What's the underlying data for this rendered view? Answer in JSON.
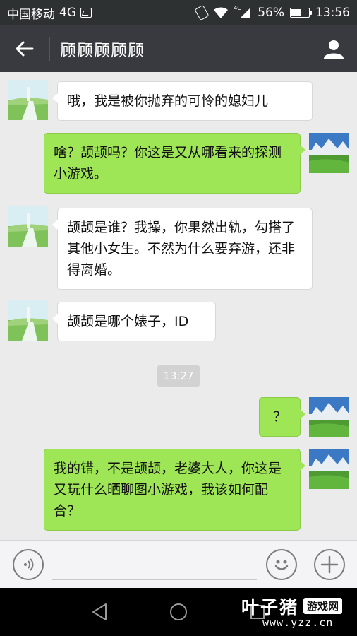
{
  "status_bar": {
    "carrier": "中国移动",
    "network": "4G",
    "signal_tag": "4G",
    "battery_percent": "56%",
    "battery_level": 0.56,
    "time": "13:56"
  },
  "header": {
    "title": "顾顾顾顾顾"
  },
  "messages": [
    {
      "side": "in",
      "text": "哦，我是被你抛弃的可怜的媳妇儿"
    },
    {
      "side": "out",
      "text": "啥？颉颉吗？你这是又从哪看来的探测小游戏。"
    },
    {
      "side": "in",
      "text": "颉颉是谁？我操，你果然出轨，勾搭了其他小女生。不然为什么要弃游，还非得离婚。"
    },
    {
      "side": "in",
      "text": "颉颉是哪个婊子，ID"
    },
    {
      "side": "out",
      "text": "？"
    },
    {
      "side": "out",
      "text": "我的错，不是颉颉，老婆大人，你这是又玩什么晒聊图小游戏，我该如何配合？"
    }
  ],
  "timestamp": "13:27",
  "input": {
    "value": "",
    "placeholder": ""
  },
  "watermark": {
    "title": "叶子猪",
    "badge": "游戏网",
    "url": "www.yzz.cn"
  },
  "colors": {
    "status_bar": "#2e3132",
    "header": "#393a3f",
    "chat_bg": "#ebebeb",
    "bubble_out": "#9fe657",
    "bubble_in": "#ffffff"
  }
}
